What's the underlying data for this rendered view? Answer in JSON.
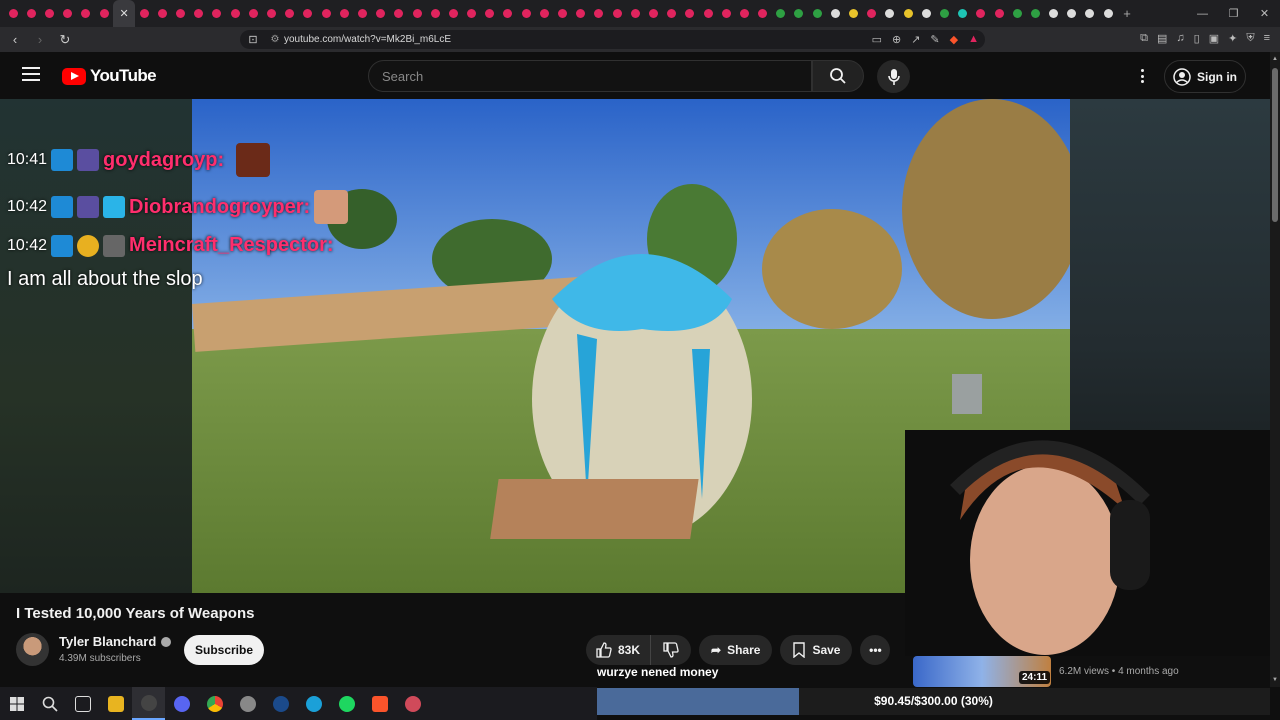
{
  "browser": {
    "url": "youtube.com/watch?v=Mk2Bi_m6LcE",
    "new_tab_symbol": "+",
    "tab_close_symbol": "✕"
  },
  "youtube": {
    "logo_text": "YouTube",
    "search_placeholder": "Search",
    "signin_label": "Sign in"
  },
  "chat": [
    {
      "time": "10:41",
      "user": "goydagroyp:",
      "message": ""
    },
    {
      "time": "10:42",
      "user": "Diobrandogroyper:",
      "message": ""
    },
    {
      "time": "10:42",
      "user": "Meincraft_Respector:",
      "message": "I am all about the slop"
    }
  ],
  "video": {
    "title": "I Tested 10,000 Years of Weapons",
    "channel": "Tyler Blanchard",
    "subscribers": "4.39M subscribers",
    "subscribe_label": "Subscribe",
    "likes": "83K",
    "share_label": "Share",
    "save_label": "Save"
  },
  "recommended": {
    "duration": "24:11",
    "meta": "6.2M views • 4 months ago"
  },
  "donation": {
    "message": "wurzye nened money",
    "progress_text": "$90.45/$300.00 (30%)",
    "progress_fraction": 0.3
  },
  "colors": {
    "chat_username": "#ff2e6d",
    "yt_red": "#ff0000",
    "progress_fill": "#4a6a9a"
  }
}
